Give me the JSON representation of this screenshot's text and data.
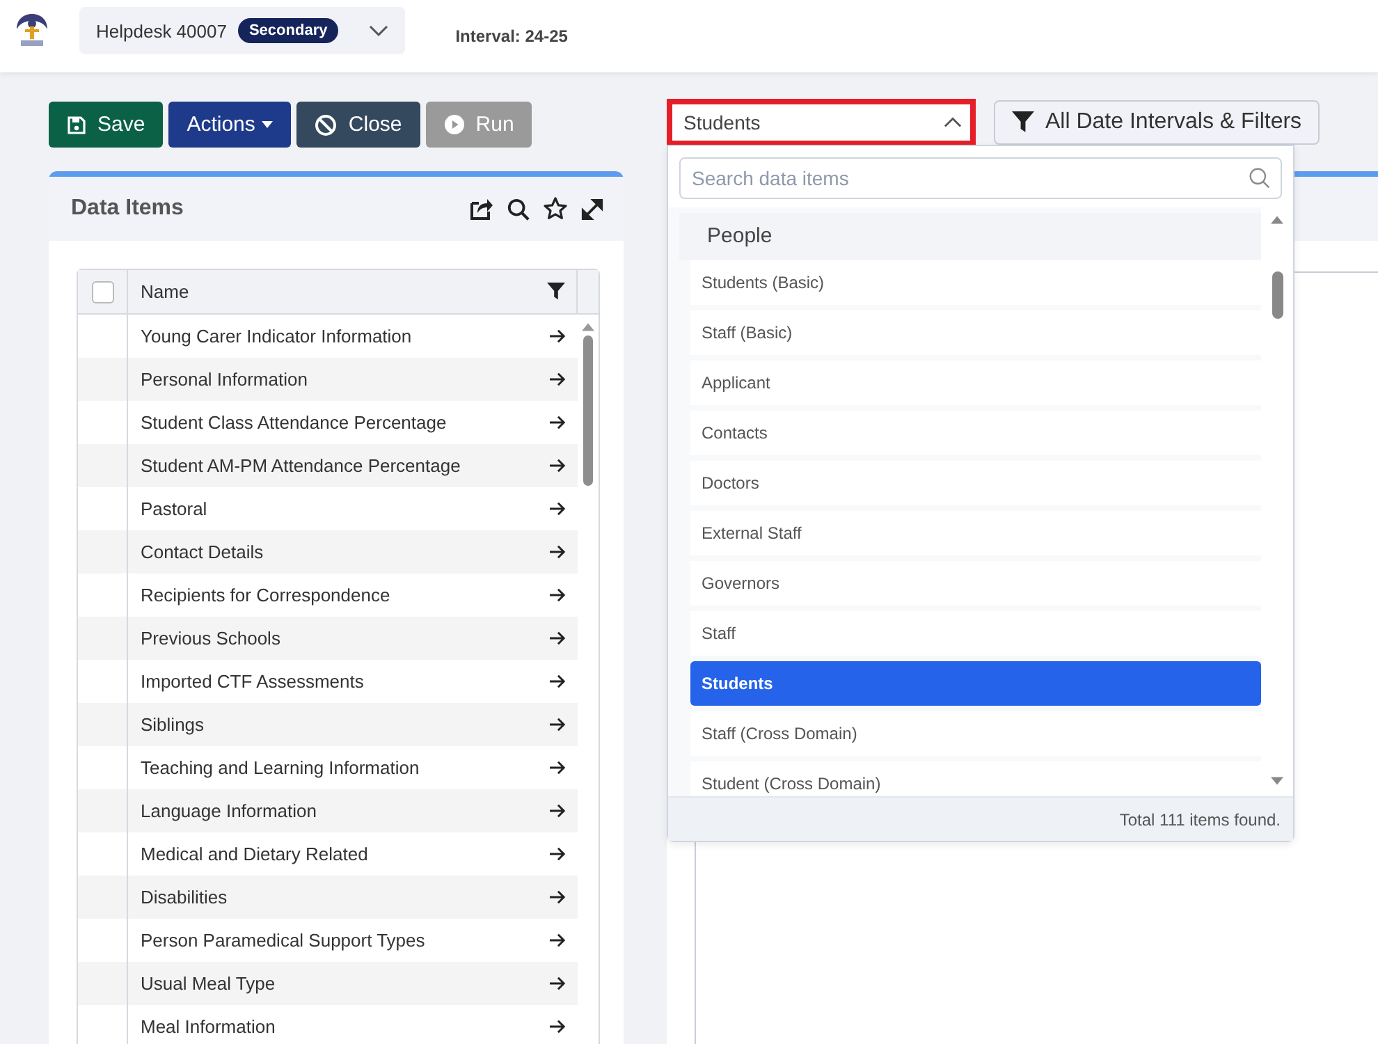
{
  "header": {
    "school": "Helpdesk 40007",
    "badge": "Secondary",
    "interval": "Interval: 24-25"
  },
  "toolbar": {
    "buttons": [
      {
        "label": "Save",
        "kind": "save",
        "disabled": false
      },
      {
        "label": "Actions",
        "kind": "actions",
        "disabled": false
      },
      {
        "label": "Close",
        "kind": "close",
        "disabled": false
      },
      {
        "label": "Run",
        "kind": "run",
        "disabled": true
      }
    ]
  },
  "selector": {
    "value": "Students",
    "expanded": true
  },
  "filter_button": {
    "label": "All Date Intervals & Filters"
  },
  "dropdown": {
    "search": {
      "placeholder": "Search data items"
    },
    "group": "People",
    "items": [
      {
        "label": "Students (Basic)",
        "selected": false
      },
      {
        "label": "Staff (Basic)",
        "selected": false
      },
      {
        "label": "Applicant",
        "selected": false
      },
      {
        "label": "Contacts",
        "selected": false
      },
      {
        "label": "Doctors",
        "selected": false
      },
      {
        "label": "External Staff",
        "selected": false
      },
      {
        "label": "Governors",
        "selected": false
      },
      {
        "label": "Staff",
        "selected": false
      },
      {
        "label": "Students",
        "selected": true
      },
      {
        "label": "Staff (Cross Domain)",
        "selected": false
      },
      {
        "label": "Student (Cross Domain)",
        "selected": false
      }
    ],
    "footer": "Total 111 items found."
  },
  "data_items": {
    "title": "Data Items",
    "table": {
      "columns": [
        "Name"
      ],
      "all_checked": false,
      "rows": [
        "Young Carer Indicator Information",
        "Personal Information",
        "Student Class Attendance Percentage",
        "Student AM-PM Attendance Percentage",
        "Pastoral",
        "Contact Details",
        "Recipients for Correspondence",
        "Previous Schools",
        "Imported CTF Assessments",
        "Siblings",
        "Teaching and Learning Information",
        "Language Information",
        "Medical and Dietary Related",
        "Disabilities",
        "Person Paramedical Support Types",
        "Usual Meal Type",
        "Meal Information"
      ]
    }
  }
}
